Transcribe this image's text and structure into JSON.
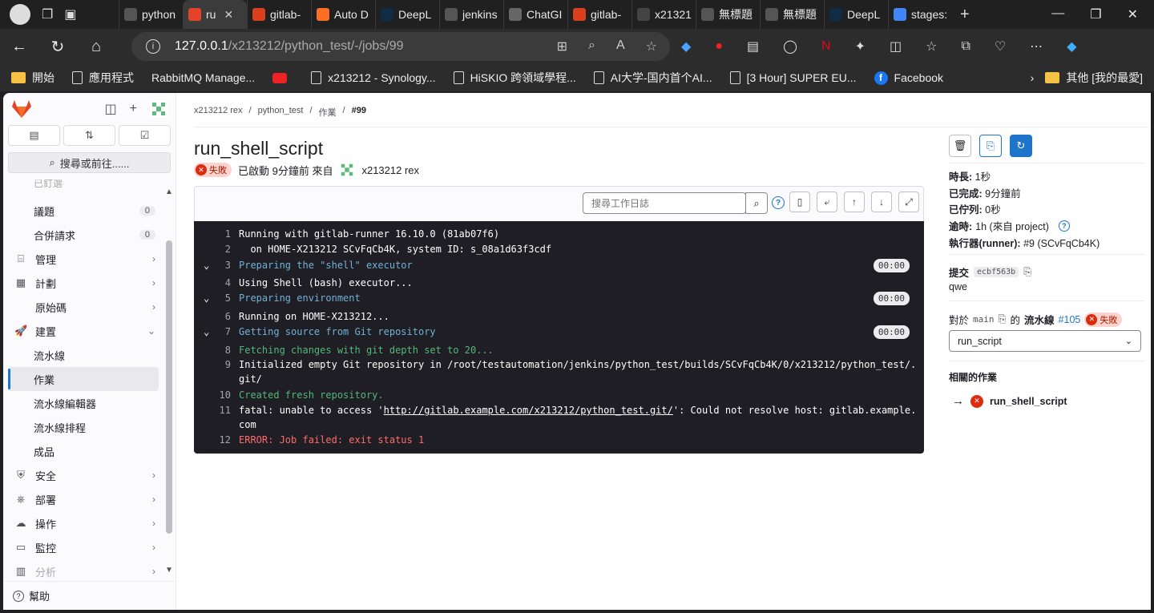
{
  "browser": {
    "tabs": [
      {
        "title": "python",
        "fav_color": "#555"
      },
      {
        "title": "ru",
        "fav_color": "#e24329",
        "active": true
      },
      {
        "title": "gitlab-",
        "fav_color": "#d9411e"
      },
      {
        "title": "Auto D",
        "fav_color": "#fc6d26"
      },
      {
        "title": "DeepL",
        "fav_color": "#0f2b46"
      },
      {
        "title": "jenkins",
        "fav_color": "#555"
      },
      {
        "title": "ChatGI",
        "fav_color": "#666"
      },
      {
        "title": "gitlab-",
        "fav_color": "#d9411e"
      },
      {
        "title": "x21321",
        "fav_color": "#444"
      },
      {
        "title": "無標題",
        "fav_color": "#555"
      },
      {
        "title": "無標題",
        "fav_color": "#555"
      },
      {
        "title": "DeepL",
        "fav_color": "#0f2b46"
      },
      {
        "title": "stages:",
        "fav_color": "#4285f4"
      }
    ],
    "url_host": "127.0.0.1",
    "url_path": "/x213212/python_test/-/jobs/99",
    "bookmarks": [
      {
        "label": "開始",
        "kind": "folder"
      },
      {
        "label": "應用程式",
        "kind": "doc"
      },
      {
        "label": "RabbitMQ Manage...",
        "kind": "none"
      },
      {
        "label": "",
        "kind": "yt"
      },
      {
        "label": "x213212 - Synology...",
        "kind": "doc"
      },
      {
        "label": "HiSKIO 跨領域學程...",
        "kind": "doc"
      },
      {
        "label": "AI大学-国内首个AI...",
        "kind": "doc"
      },
      {
        "label": "[3 Hour] SUPER EU...",
        "kind": "doc"
      },
      {
        "label": "Facebook",
        "kind": "fb"
      }
    ],
    "other_bookmarks": "其他 [我的最愛]"
  },
  "sidebar": {
    "search_label": "搜尋或前往......",
    "top_faded": "已釘選",
    "items": [
      {
        "label": "議題",
        "count": "0",
        "sub": true
      },
      {
        "label": "合併請求",
        "count": "0",
        "sub": true
      },
      {
        "label": "管理",
        "icon": "briefcase-icon"
      },
      {
        "label": "計劃",
        "icon": "calendar-icon"
      },
      {
        "label": "原始碼",
        "icon": "code-icon"
      },
      {
        "label": "建置",
        "icon": "rocket-icon",
        "expanded": true
      },
      {
        "label": "流水線",
        "sub": true
      },
      {
        "label": "作業",
        "sub": true,
        "active": true
      },
      {
        "label": "流水線編輯器",
        "sub": true
      },
      {
        "label": "流水線排程",
        "sub": true
      },
      {
        "label": "成品",
        "sub": true
      },
      {
        "label": "安全",
        "icon": "shield-icon"
      },
      {
        "label": "部署",
        "icon": "deploy-icon"
      },
      {
        "label": "操作",
        "icon": "cloud-icon"
      },
      {
        "label": "監控",
        "icon": "monitor-icon"
      },
      {
        "label": "分析",
        "icon": "chart-icon",
        "faded": true
      }
    ],
    "help": "幫助"
  },
  "breadcrumb": [
    "x213212 rex",
    "python_test",
    "作業",
    "#99"
  ],
  "job": {
    "title": "run_shell_script",
    "status": "失敗",
    "started": "已啟動 9分鐘前 來自",
    "user": "x213212 rex"
  },
  "log_toolbar": {
    "search_placeholder": "搜尋工作日誌"
  },
  "log_lines": [
    {
      "n": "1",
      "text": "Running with gitlab-runner 16.10.0 (81ab07f6)",
      "color": "white"
    },
    {
      "n": "2",
      "text": "  on HOME-X213212 SCvFqCb4K, system ID: s_08a1d63f3cdf",
      "color": "white"
    },
    {
      "n": "3",
      "text": "Preparing the \"shell\" executor",
      "color": "cyan",
      "section": true,
      "time": "00:00"
    },
    {
      "n": "4",
      "text": "Using Shell (bash) executor...",
      "color": "white"
    },
    {
      "n": "5",
      "text": "Preparing environment",
      "color": "cyan",
      "section": true,
      "time": "00:00"
    },
    {
      "n": "6",
      "text": "Running on HOME-X213212...",
      "color": "white"
    },
    {
      "n": "7",
      "text": "Getting source from Git repository",
      "color": "cyan",
      "section": true,
      "time": "00:00"
    },
    {
      "n": "8",
      "text": "Fetching changes with git depth set to 20...",
      "color": "green"
    },
    {
      "n": "9",
      "text": "Initialized empty Git repository in /root/testautomation/jenkins/python_test/builds/SCvFqCb4K/0/x213212/python_test/.",
      "color": "white"
    },
    {
      "n": "",
      "text": "git/",
      "color": "white"
    },
    {
      "n": "10",
      "text": "Created fresh repository.",
      "color": "green"
    },
    {
      "n": "11",
      "text": "fatal: unable to access 'http://gitlab.example.com/x213212/python_test.git/': Could not resolve host: gitlab.example.",
      "color": "white"
    },
    {
      "n": "",
      "text": "com",
      "color": "white"
    },
    {
      "n": "12",
      "text": "ERROR: Job failed: exit status 1",
      "color": "red"
    }
  ],
  "details": {
    "duration_label": "時長:",
    "duration": "1秒",
    "finished_label": "已完成:",
    "finished": "9分鐘前",
    "queued_label": "已佇列:",
    "queued": "0秒",
    "timeout_label": "逾時:",
    "timeout": "1h (來自 project)",
    "runner_label": "執行器(runner):",
    "runner": "#9 (SCvFqCb4K)",
    "commit_label": "提交",
    "commit_sha": "ecbf563b",
    "commit_msg": "qwe",
    "pipeline_pre": "對於",
    "pipeline_branch": "main",
    "pipeline_mid": "的",
    "pipeline_label": "流水線",
    "pipeline_id": "#105",
    "pipeline_status": "失敗",
    "stage_select": "run_script",
    "related_title": "相關的作業",
    "related_job": "run_shell_script"
  }
}
